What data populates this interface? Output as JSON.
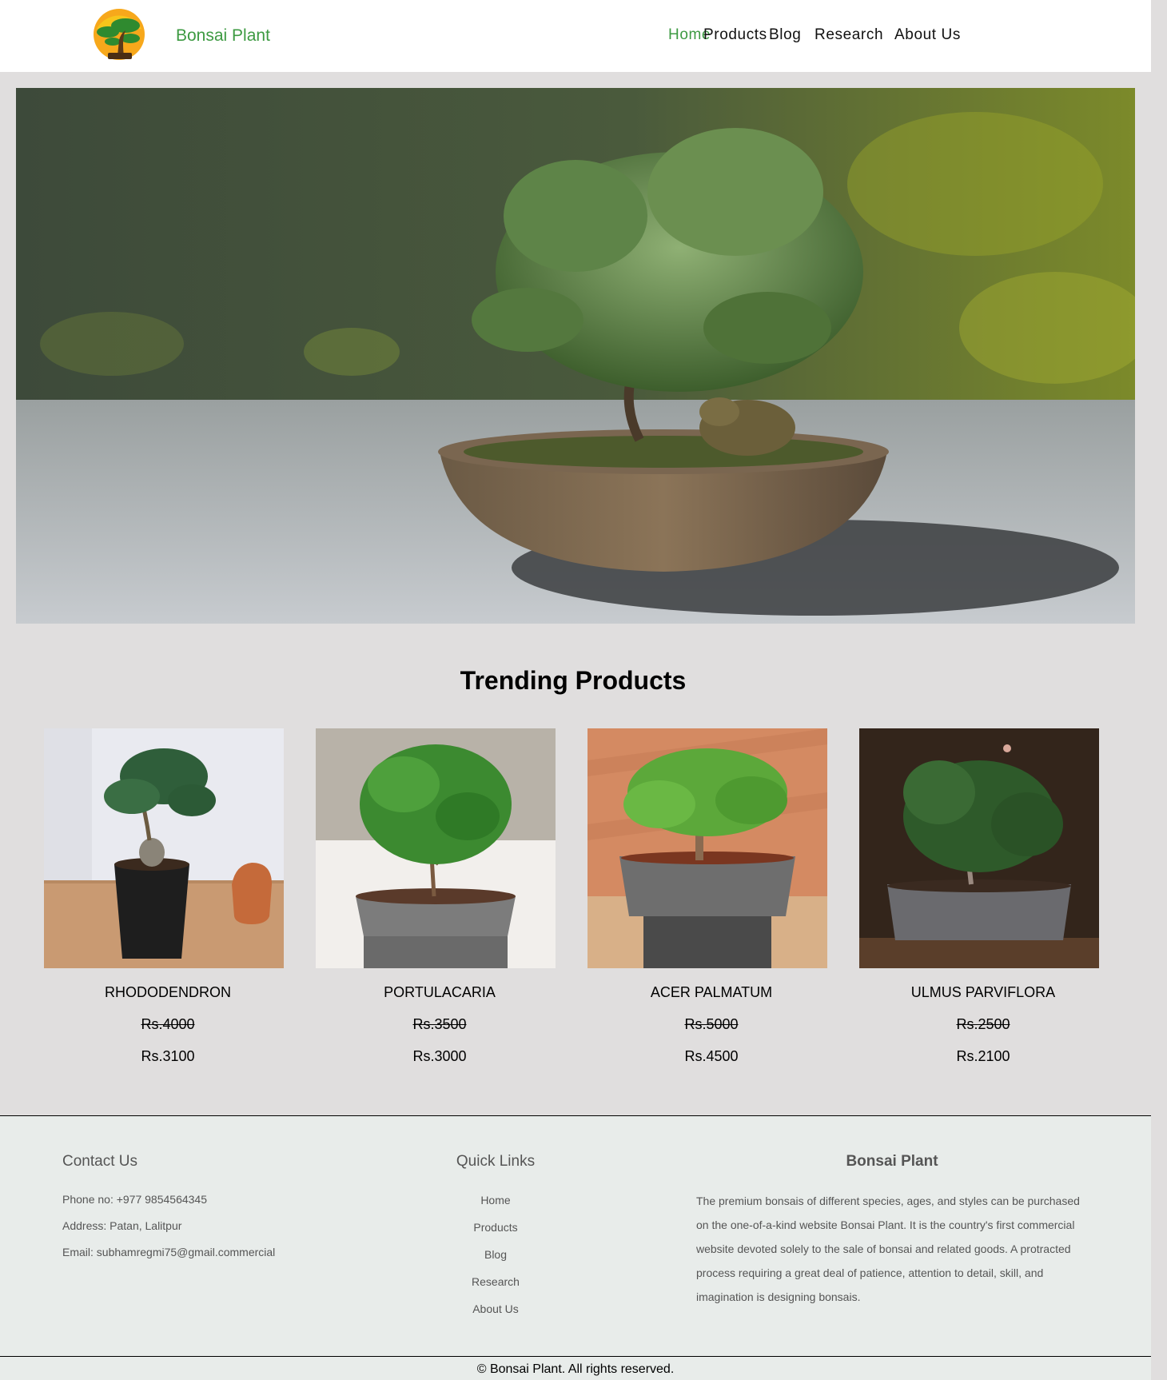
{
  "header": {
    "brand": "Bonsai Plant",
    "nav": [
      {
        "label": "Home",
        "active": true
      },
      {
        "label": "Products",
        "active": false
      },
      {
        "label": "Blog",
        "active": false
      },
      {
        "label": "Research",
        "active": false
      },
      {
        "label": "About Us",
        "active": false
      }
    ]
  },
  "main": {
    "section_title": "Trending Products",
    "products": [
      {
        "name": "RHODODENDRON",
        "old_price": "Rs.4000",
        "price": "Rs.3100"
      },
      {
        "name": "PORTULACARIA",
        "old_price": "Rs.3500",
        "price": "Rs.3000"
      },
      {
        "name": "ACER PALMATUM",
        "old_price": "Rs.5000",
        "price": "Rs.4500"
      },
      {
        "name": "ULMUS PARVIFLORA",
        "old_price": "Rs.2500",
        "price": "Rs.2100"
      }
    ]
  },
  "footer": {
    "contact": {
      "title": "Contact Us",
      "phone": "Phone no: +977 9854564345",
      "address": "Address: Patan, Lalitpur",
      "email": "Email: subhamregmi75@gmail.commercial"
    },
    "quick_links": {
      "title": "Quick Links",
      "links": [
        "Home",
        "Products",
        "Blog",
        "Research",
        "About Us"
      ]
    },
    "about": {
      "title": "Bonsai Plant",
      "text": "The premium bonsais of different species, ages, and styles can be purchased on the one-of-a-kind website Bonsai Plant. It is the country's first commercial website devoted solely to the sale of bonsai and related goods. A protracted process requiring a great deal of patience, attention to detail, skill, and imagination is designing bonsais."
    },
    "copyright": "© Bonsai Plant. All rights reserved."
  },
  "colors": {
    "accent": "#3d9a42",
    "page_bg": "#e0dede",
    "footer_bg": "#e8ecea"
  }
}
